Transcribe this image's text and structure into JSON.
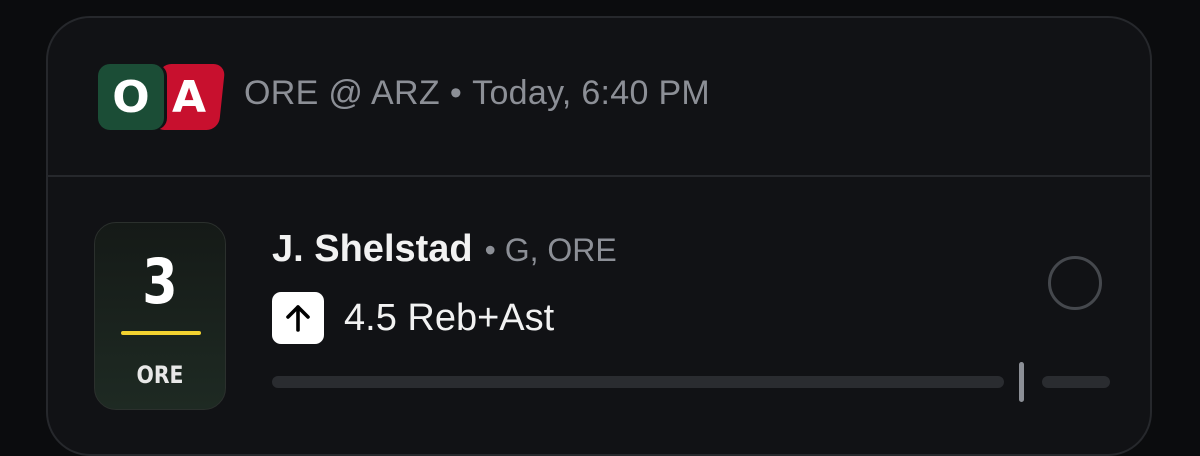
{
  "game": {
    "away_team": {
      "abbr": "ORE",
      "logo_letter": "O",
      "color": "#1b4d36"
    },
    "home_team": {
      "abbr": "ARZ",
      "logo_letter": "A",
      "color": "#c8102e"
    },
    "matchup": "ORE @ ARZ",
    "separator": "•",
    "time": "Today, 6:40 PM"
  },
  "player": {
    "jersey_number": "3",
    "jersey_team": "ORE",
    "jersey_accent_color": "#f2d230",
    "name": "J. Shelstad",
    "meta_separator": "•",
    "position_team": "G, ORE"
  },
  "pick": {
    "direction_icon": "arrow-up-icon",
    "line_text": "4.5 Reb+Ast"
  },
  "progress": {
    "current_fraction": 0
  }
}
